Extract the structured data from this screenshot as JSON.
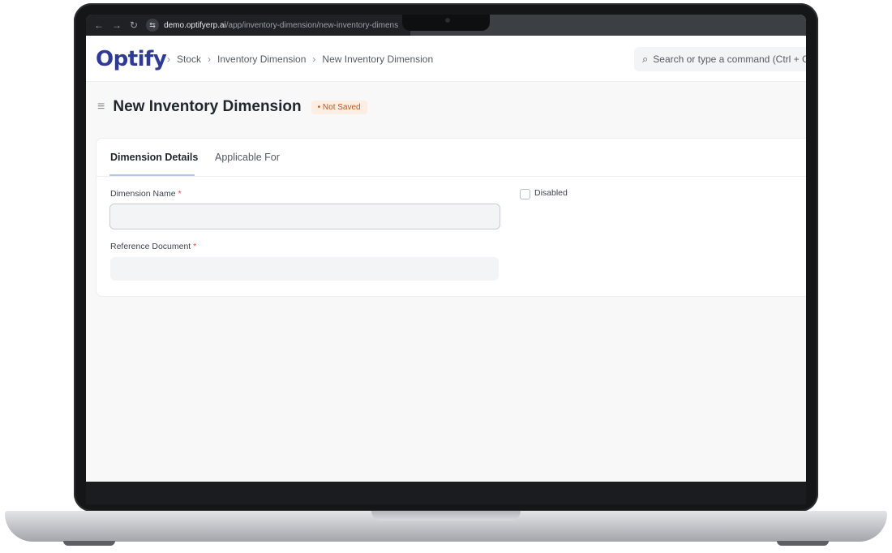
{
  "browser": {
    "url_domain": "demo.optifyerp.ai",
    "url_path": "/app/inventory-dimension/new-inventory-dimens",
    "back_glyph": "←",
    "forward_glyph": "→",
    "reload_glyph": "↻",
    "site_info_glyph": "⇆"
  },
  "header": {
    "logo_text": "Optify",
    "breadcrumb": [
      "Stock",
      "Inventory Dimension",
      "New Inventory Dimension"
    ],
    "breadcrumb_separator": "›",
    "search_placeholder": "Search or type a command (Ctrl + G)",
    "search_icon": "⌕"
  },
  "page": {
    "menu_icon": "≡",
    "title": "New Inventory Dimension",
    "status": "• Not Saved"
  },
  "tabs": [
    {
      "label": "Dimension Details",
      "active": true
    },
    {
      "label": "Applicable For",
      "active": false
    }
  ],
  "form": {
    "dimension_name": {
      "label": "Dimension Name",
      "required_mark": "*",
      "value": ""
    },
    "reference_document": {
      "label": "Reference Document",
      "required_mark": "*",
      "value": ""
    },
    "disabled": {
      "label": "Disabled",
      "checked": false
    }
  },
  "colors": {
    "brand": "#2f3a96",
    "status_badge_bg": "#fdeee3",
    "status_badge_text": "#c0571a",
    "required": "#e24c4c"
  }
}
